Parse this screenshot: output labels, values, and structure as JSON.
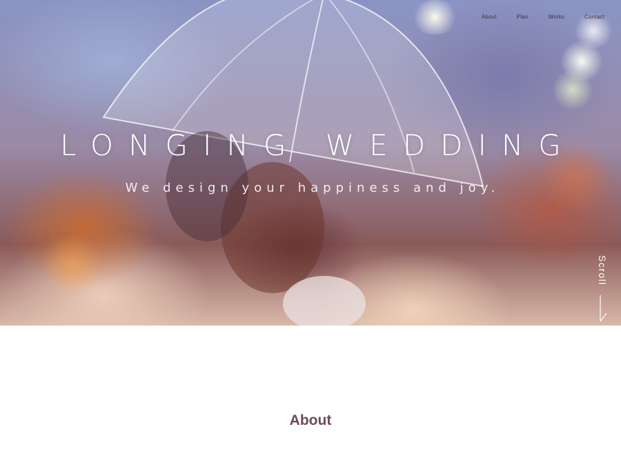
{
  "nav": {
    "items": [
      {
        "label": "About"
      },
      {
        "label": "Plan"
      },
      {
        "label": "Works"
      },
      {
        "label": "Contact"
      }
    ]
  },
  "hero": {
    "title": "LONGING WEDDING",
    "tagline": "We design your happiness and joy.",
    "scroll_label": "Scroll"
  },
  "about": {
    "heading": "About"
  },
  "colors": {
    "accent": "#6e4a5a",
    "nav_text": "#3a3440",
    "hero_text": "#ffffff"
  },
  "icons": {
    "scroll": "arrow-down-icon"
  }
}
